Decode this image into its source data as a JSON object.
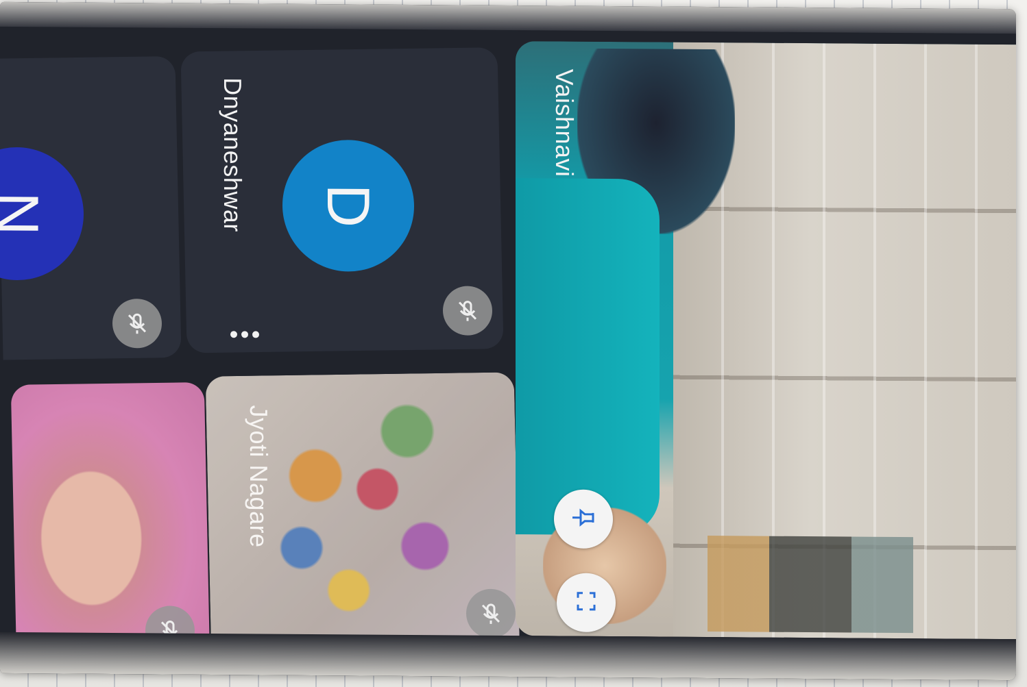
{
  "participants": [
    {
      "name": "",
      "initial": "N",
      "avatar_color": "#2431b6",
      "muted": true
    },
    {
      "name": "Dnyaneshwar",
      "initial": "D",
      "avatar_color": "#1283c8",
      "muted": true,
      "more_menu": true
    },
    {
      "name": "",
      "video": true,
      "muted": true
    },
    {
      "name": "Jyoti Nagare",
      "video": true,
      "muted": true,
      "more_menu": true
    },
    {
      "name": "Vaishnavi",
      "video": true,
      "pinned_controls": [
        "pin-icon",
        "fullscreen-icon"
      ]
    }
  ],
  "icons": {
    "muted": "mic-off-icon",
    "more": "more-options-icon",
    "pin": "pin-icon",
    "fullscreen": "fullscreen-icon"
  },
  "colors": {
    "tile_background": "#2b2f3a",
    "muted_badge": "#969696",
    "action_button": "#f4f4f4",
    "icon_accent": "#2b6fd6"
  }
}
